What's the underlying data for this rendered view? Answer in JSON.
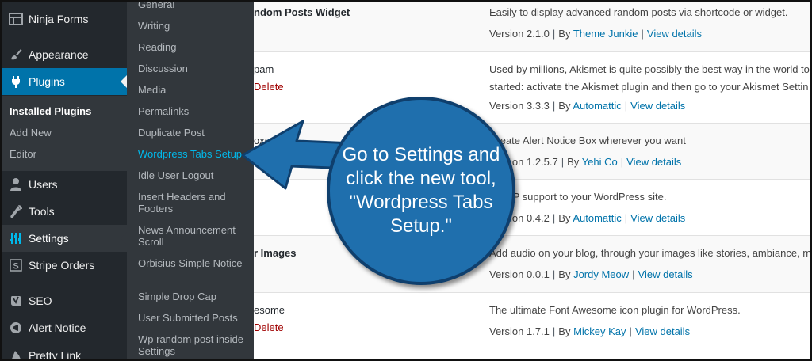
{
  "sidebar": {
    "items": [
      {
        "id": "ninja-forms",
        "label": "Ninja Forms",
        "icon": "table-icon"
      },
      {
        "id": "appearance",
        "label": "Appearance",
        "icon": "paintbrush-icon"
      },
      {
        "id": "plugins",
        "label": "Plugins",
        "icon": "plug-icon"
      },
      {
        "id": "users",
        "label": "Users",
        "icon": "user-icon"
      },
      {
        "id": "tools",
        "label": "Tools",
        "icon": "wrench-icon"
      },
      {
        "id": "settings",
        "label": "Settings",
        "icon": "sliders-icon"
      },
      {
        "id": "stripe-orders",
        "label": "Stripe Orders",
        "icon": "s-icon"
      },
      {
        "id": "seo",
        "label": "SEO",
        "icon": "yoast-icon"
      },
      {
        "id": "alert-notice",
        "label": "Alert Notice",
        "icon": "megaphone-icon"
      },
      {
        "id": "pretty-link",
        "label": "Pretty Link",
        "icon": "pretty-link-icon"
      }
    ],
    "plugins_submenu": [
      "Installed Plugins",
      "Add New",
      "Editor"
    ]
  },
  "settings_flyout": [
    "General",
    "Writing",
    "Reading",
    "Discussion",
    "Media",
    "Permalinks",
    "Duplicate Post",
    "Wordpress Tabs Setup",
    "Idle User Logout",
    "Insert Headers and Footers",
    "News Announcement Scroll",
    "Orbisius Simple Notice",
    "Simple Drop Cap",
    "User Submitted Posts",
    "Wp random post inside Settings"
  ],
  "plugins_table": {
    "rows": [
      {
        "name": "ndom Posts Widget",
        "action": "",
        "description": "Easily to display advanced random posts via shortcode or widget.",
        "version": "Version 2.1.0",
        "by": "By",
        "author": "Theme Junkie",
        "details": "View details"
      },
      {
        "name": "pam",
        "action": "Delete",
        "description": "Used by millions, Akismet is quite possibly the best way in the world to",
        "description2": "started: activate the Akismet plugin and then go to your Akismet Settin",
        "version": "Version 3.3.3",
        "by": "By",
        "author": "Automattic",
        "details": "View details"
      },
      {
        "name": "oxes",
        "action": "",
        "description": "Create Alert Notice Box wherever you want",
        "version": "Version 1.2.5.7",
        "by": "By",
        "author": "Yehi Co",
        "details": "View details"
      },
      {
        "name": "",
        "action": "",
        "description": "d AMP support to your WordPress site.",
        "version": "Version 0.4.2",
        "by": "By",
        "author": "Automattic",
        "details": "View details"
      },
      {
        "name": "r Images",
        "action": "",
        "description": "Add audio on your blog, through your images like stories, ambiance, m",
        "version": "Version 0.0.1",
        "by": "By",
        "author": "Jordy Meow",
        "details": "View details"
      },
      {
        "name": "esome",
        "action": "Delete",
        "description": "The ultimate Font Awesome icon plugin for WordPress.",
        "version": "Version 1.7.1",
        "by": "By",
        "author": "Mickey Kay",
        "details": "View details"
      }
    ]
  },
  "callout": {
    "text": "Go to Settings and click the new tool, \"Wordpress Tabs Setup.\""
  },
  "colors": {
    "sidebar_bg": "#23282d",
    "submenu_bg": "#32373c",
    "active_blue": "#0073aa",
    "highlight_link": "#00b9eb",
    "bubble_fill": "#1f6fad",
    "bubble_border": "#0f3f6d"
  }
}
